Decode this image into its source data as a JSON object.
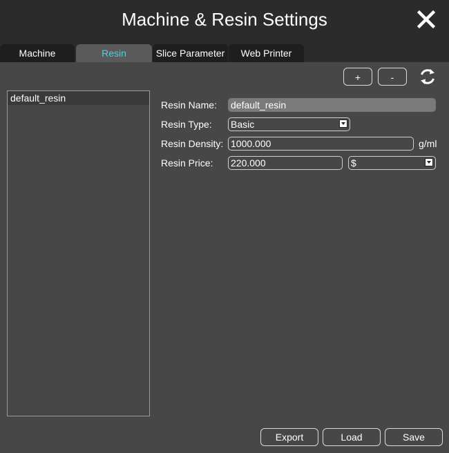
{
  "window": {
    "title": "Machine & Resin Settings"
  },
  "tabs": [
    {
      "label": "Machine",
      "active": false
    },
    {
      "label": "Resin",
      "active": true
    },
    {
      "label": "Slice Parameter",
      "active": false
    },
    {
      "label": "Web Printer",
      "active": false
    }
  ],
  "toolbar": {
    "add_label": "+",
    "remove_label": "-"
  },
  "resin_list": {
    "items": [
      "default_resin"
    ],
    "selected": "default_resin"
  },
  "form": {
    "name": {
      "label": "Resin Name:",
      "value": "default_resin"
    },
    "type": {
      "label": "Resin Type:",
      "value": "Basic"
    },
    "density": {
      "label": "Resin Density:",
      "value": "1000.000",
      "unit": "g/ml"
    },
    "price": {
      "label": "Resin Price:",
      "value": "220.000",
      "currency": "$"
    }
  },
  "actions": {
    "export_label": "Export",
    "load_label": "Load",
    "save_label": "Save"
  },
  "colors": {
    "accent": "#3fd8e0",
    "background": "#474747",
    "titlebar": "#2b2b2b"
  },
  "icons": {
    "close": "close-icon",
    "refresh": "refresh-icon"
  }
}
